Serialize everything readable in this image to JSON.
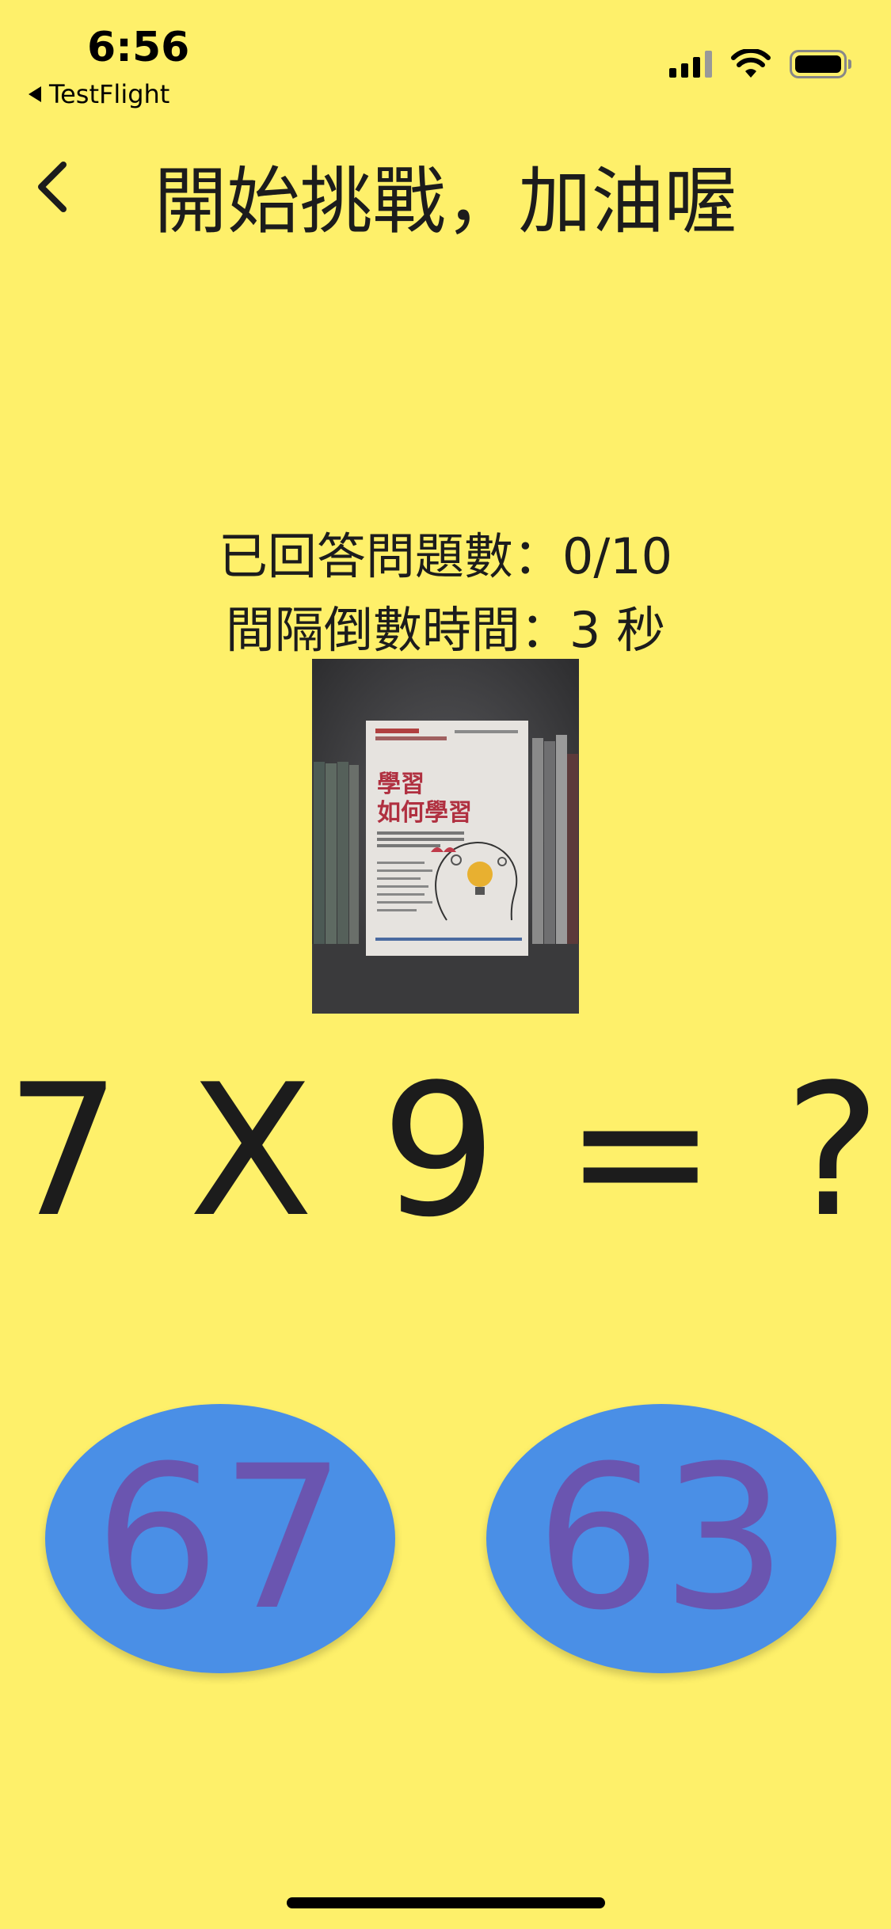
{
  "status_bar": {
    "time": "6:56",
    "back_app": "TestFlight",
    "icons": [
      "signal-icon",
      "wifi-icon",
      "battery-icon"
    ]
  },
  "nav": {
    "back_icon": "chevron-left-icon",
    "title": "開始挑戰，加油喔"
  },
  "stats": {
    "answered": "已回答問題數：0/10",
    "countdown": "間隔倒數時間：3 秒"
  },
  "photo": {
    "book_subtitle": "學習",
    "book_title": "如何學習"
  },
  "question": {
    "text": "7 X 9 = ?"
  },
  "answers": [
    {
      "label": "67"
    },
    {
      "label": "63"
    }
  ],
  "colors": {
    "background": "#FEF06A",
    "button": "#4A8FE6",
    "button_text": "#6A55B0",
    "text": "#1C1C1C"
  }
}
